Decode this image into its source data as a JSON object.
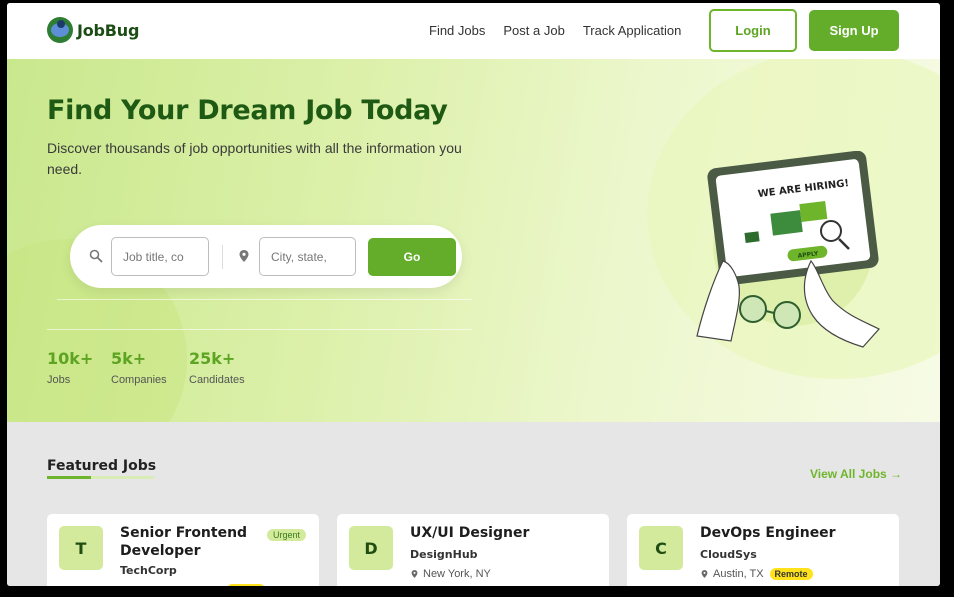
{
  "brand": {
    "name": "JobBug"
  },
  "nav": {
    "links": [
      "Find Jobs",
      "Post a Job",
      "Track Application"
    ],
    "login": "Login",
    "signup": "Sign Up"
  },
  "hero": {
    "title": "Find Your Dream Job Today",
    "subtitle": "Discover thousands of job opportunities with all the information you need.",
    "search": {
      "job_placeholder": "Job title, co",
      "location_placeholder": "City, state,",
      "go": "Go"
    },
    "stats": [
      {
        "value": "10k+",
        "label": "Jobs"
      },
      {
        "value": "5k+",
        "label": "Companies"
      },
      {
        "value": "25k+",
        "label": "Candidates"
      }
    ],
    "illustration": {
      "headline": "WE ARE HIRING!",
      "button": "APPLY"
    }
  },
  "featured": {
    "title": "Featured Jobs",
    "view_all": "View All Jobs →",
    "jobs": [
      {
        "initial": "T",
        "title": "Senior Frontend Developer",
        "company": "TechCorp",
        "badge": "Urgent"
      },
      {
        "initial": "D",
        "title": "UX/UI Designer",
        "company": "DesignHub",
        "location": "New York, NY"
      },
      {
        "initial": "C",
        "title": "DevOps Engineer",
        "company": "CloudSys",
        "location": "Austin, TX",
        "badge": "Remote"
      }
    ]
  },
  "colors": {
    "primary": "#63ad2a",
    "dark_green": "#1f5a14",
    "accent_yellow": "#ffe21c"
  }
}
